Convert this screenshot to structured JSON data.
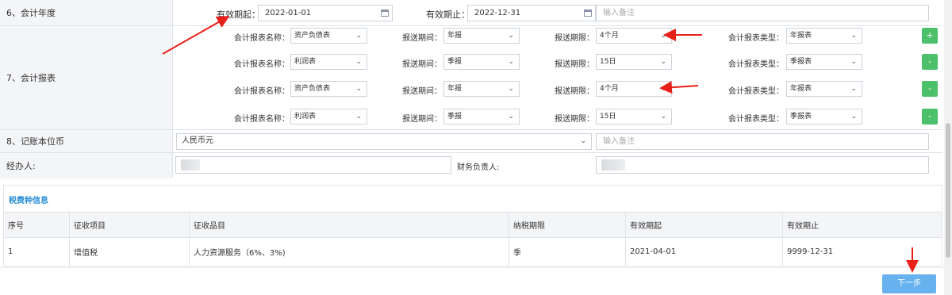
{
  "colors": {
    "accent": "#2a8fd6",
    "add_button": "#4cc06a",
    "next_button": "#66b1ee",
    "arrow": "#e8201a"
  },
  "fiscal_year": {
    "label": "6、会计年度",
    "start_label": "有效期起：",
    "start_value": "2022-01-01",
    "end_label": "有效期止：",
    "end_value": "2022-12-31",
    "remark_placeholder": "输入备注"
  },
  "reports": {
    "label": "7、会计报表",
    "name_label": "会计报表名称：",
    "period_label": "报送期间：",
    "deadline_label": "报送期限：",
    "type_label": "会计报表类型：",
    "add_label": "+",
    "remove_label": "-",
    "rows": [
      {
        "name": "资产负债表",
        "period": "年报",
        "deadline": "4个月",
        "type": "年报表"
      },
      {
        "name": "利润表",
        "period": "季报",
        "deadline": "15日",
        "type": "季报表"
      },
      {
        "name": "资产负债表",
        "period": "年报",
        "deadline": "4个月",
        "type": "年报表"
      },
      {
        "name": "利润表",
        "period": "季报",
        "deadline": "15日",
        "type": "季报表"
      }
    ]
  },
  "currency": {
    "label": "8、记账本位币",
    "value": "人民币元",
    "remark_placeholder": "输入备注"
  },
  "handler": {
    "label": "经办人:",
    "finance_label": "财务负责人:"
  },
  "tax": {
    "title": "税费种信息",
    "headers": [
      "序号",
      "征收项目",
      "征收品目",
      "纳税期限",
      "有效期起",
      "有效期止"
    ],
    "rows": [
      [
        "1",
        "增值税",
        "人力资源服务（6%、3%)",
        "季",
        "2021-04-01",
        "9999-12-31"
      ]
    ]
  },
  "next_button": "下一步"
}
